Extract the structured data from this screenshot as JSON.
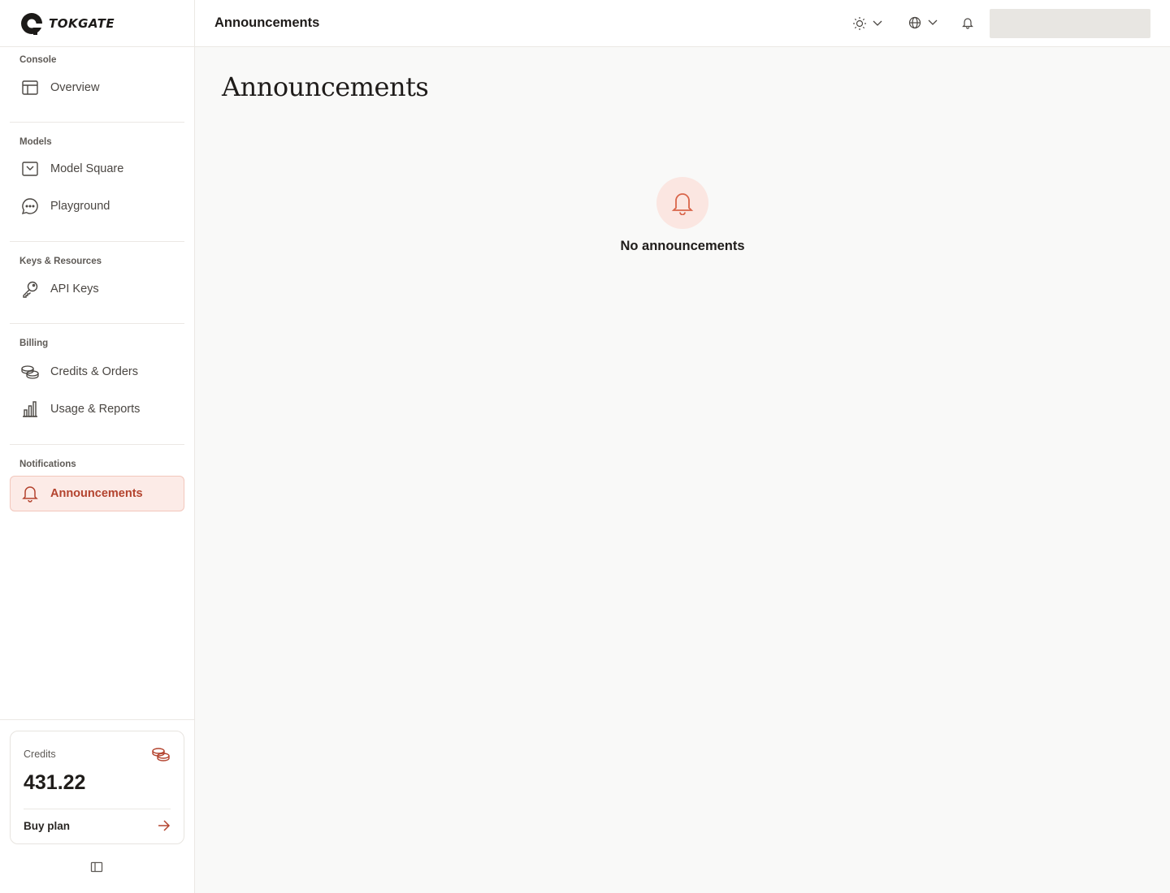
{
  "brand": {
    "name": "TOKGATE"
  },
  "header": {
    "title": "Announcements"
  },
  "page": {
    "heading": "Announcements",
    "empty_text": "No announcements"
  },
  "sidebar": {
    "groups": [
      {
        "title": "Console",
        "items": [
          {
            "label": "Overview",
            "icon": "layout-icon"
          }
        ]
      },
      {
        "title": "Models",
        "items": [
          {
            "label": "Model Square",
            "icon": "inbox-icon"
          },
          {
            "label": "Playground",
            "icon": "chat-bubble-icon"
          }
        ]
      },
      {
        "title": "Keys & Resources",
        "items": [
          {
            "label": "API Keys",
            "icon": "key-icon"
          }
        ]
      },
      {
        "title": "Billing",
        "items": [
          {
            "label": "Credits & Orders",
            "icon": "coins-icon"
          },
          {
            "label": "Usage & Reports",
            "icon": "bar-chart-icon"
          }
        ]
      },
      {
        "title": "Notifications",
        "items": [
          {
            "label": "Announcements",
            "icon": "bell-icon",
            "active": true
          }
        ]
      }
    ],
    "credits": {
      "label": "Credits",
      "value": "431.22",
      "buy_label": "Buy plan"
    }
  },
  "colors": {
    "accent": "#b3432e",
    "accent_bg": "#fcebe7",
    "icon_accent": "#d9654a"
  }
}
